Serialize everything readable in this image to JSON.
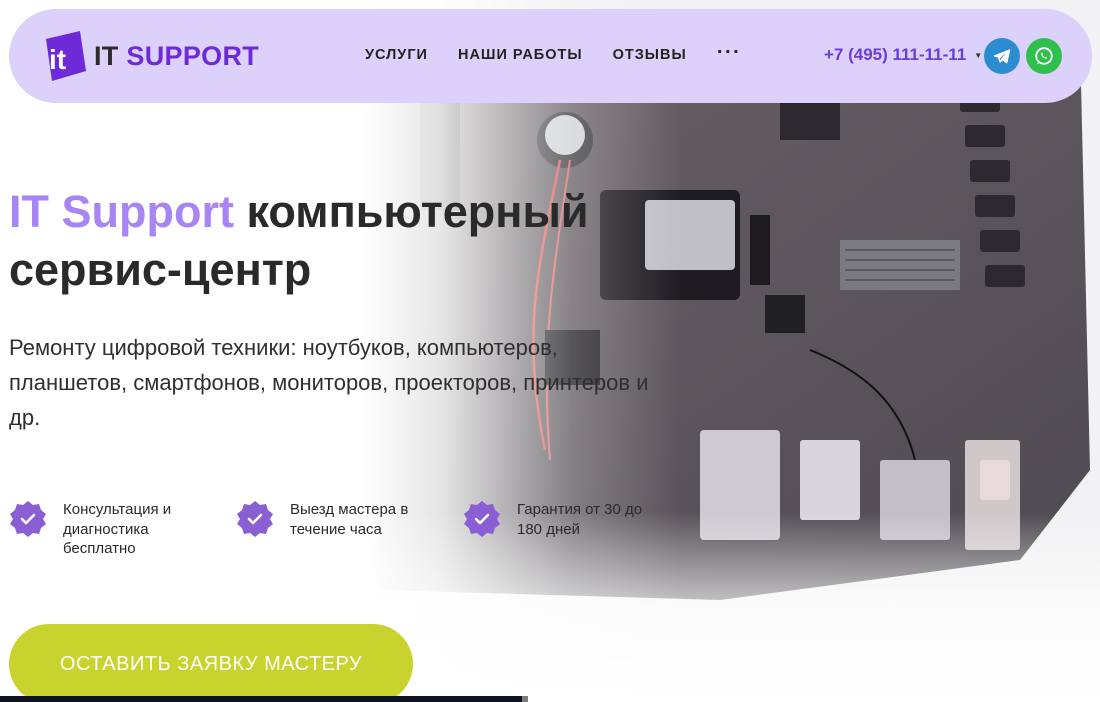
{
  "header": {
    "logo": {
      "part1": "IT",
      "part2": "SUPPORT"
    },
    "nav": [
      {
        "label": "УСЛУГИ"
      },
      {
        "label": "НАШИ РАБОТЫ"
      },
      {
        "label": "ОТЗЫВЫ"
      }
    ],
    "more_label": "···",
    "phone": "+7 (495) 111-11-11",
    "social": [
      {
        "icon": "telegram-icon",
        "color": "#2b8ccf"
      },
      {
        "icon": "whatsapp-icon",
        "color": "#2fbf4c"
      }
    ]
  },
  "hero": {
    "title_brand": "IT Support",
    "title_rest_line1": " компьютерный",
    "title_line2": "сервис-центр",
    "subtitle": "Ремонту цифровой техники: ноутбуков, компьютеров, планшетов, смартфонов, мониторов, проекторов, принтеров и др.",
    "features": [
      {
        "icon": "check-badge-icon",
        "text": "Консультация и диагностика бесплатно"
      },
      {
        "icon": "check-badge-icon",
        "text": "Выезд мастера в течение часа"
      },
      {
        "icon": "check-badge-icon",
        "text": "Гарантия от 30 до 180 дней"
      }
    ],
    "cta_label": "ОСТАВИТЬ ЗАЯВКУ МАСТЕРУ"
  },
  "colors": {
    "header_bg": "#dcd1fa",
    "brand_purple": "#a885f4",
    "accent_purple": "#6e2ad6",
    "cta_green": "#c8d32d"
  }
}
